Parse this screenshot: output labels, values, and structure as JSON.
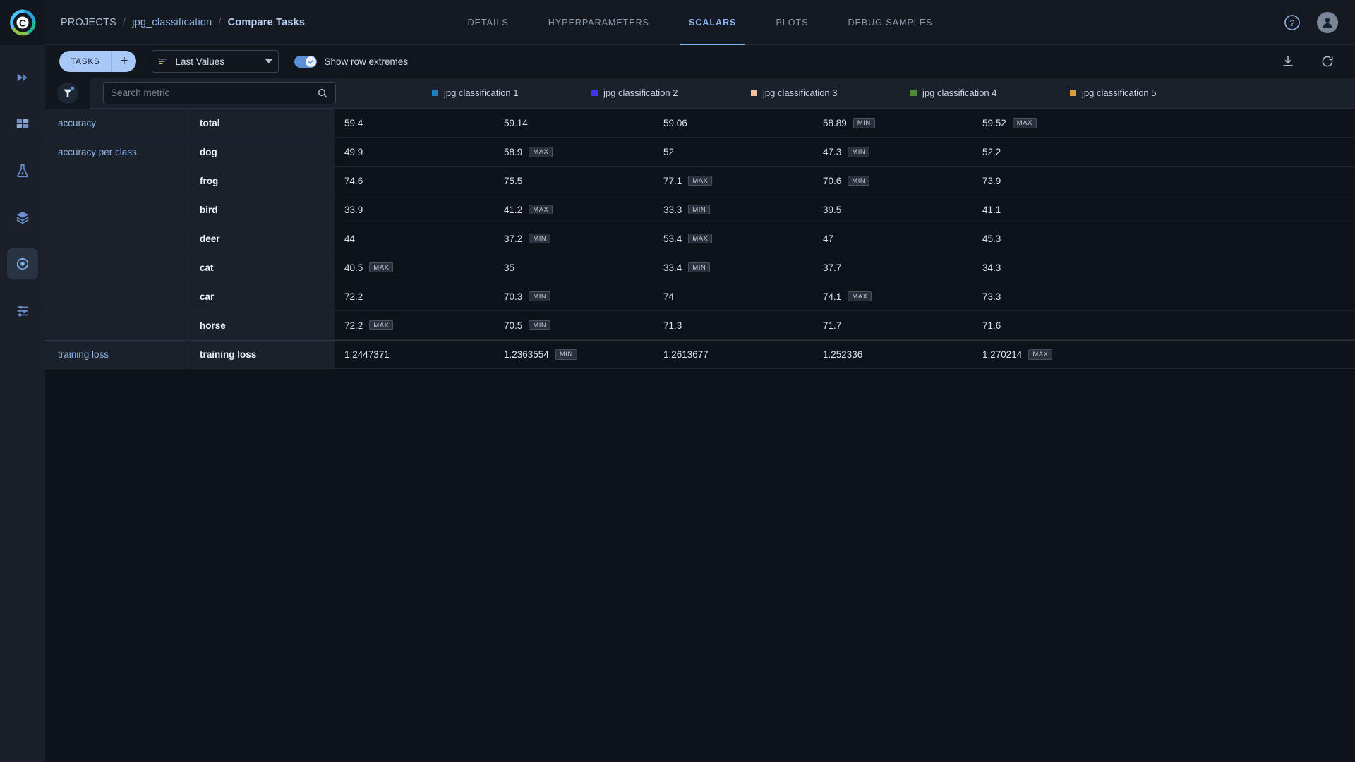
{
  "app": {
    "logo_icon": "clearml-logo-icon"
  },
  "sidebar": {
    "items": [
      {
        "name": "pipelines",
        "icon": "rocket-icon",
        "active": false
      },
      {
        "name": "datasets",
        "icon": "grid-icon",
        "active": false
      },
      {
        "name": "experiments",
        "icon": "flask-icon",
        "active": false
      },
      {
        "name": "models",
        "icon": "layers-icon",
        "active": false
      },
      {
        "name": "projects",
        "icon": "atom-icon",
        "active": true
      },
      {
        "name": "settings",
        "icon": "sliders-icon",
        "active": false
      }
    ]
  },
  "header": {
    "breadcrumb": {
      "projects": "PROJECTS",
      "separator": "/",
      "project": "jpg_classification",
      "current": "Compare Tasks"
    },
    "tabs": [
      {
        "label": "DETAILS",
        "active": false
      },
      {
        "label": "HYPERPARAMETERS",
        "active": false
      },
      {
        "label": "SCALARS",
        "active": true
      },
      {
        "label": "PLOTS",
        "active": false
      },
      {
        "label": "DEBUG SAMPLES",
        "active": false
      }
    ],
    "help_icon": "help-circle-icon",
    "avatar_icon": "user-avatar-icon"
  },
  "toolbar": {
    "tasks_label": "TASKS",
    "add_label": "+",
    "values_select": "Last Values",
    "values_icon": "sort-lines-icon",
    "toggle_label": "Show row extremes",
    "toggle_on": true,
    "download_icon": "download-icon",
    "refresh_icon": "refresh-icon"
  },
  "search": {
    "placeholder": "Search metric",
    "value": "",
    "search_icon": "search-icon",
    "filter_icon": "filter-funnel-icon"
  },
  "table": {
    "columns": [
      {
        "label": "jpg classification 1",
        "color": "#1f7fb8"
      },
      {
        "label": "jpg classification 2",
        "color": "#3b36e8"
      },
      {
        "label": "jpg classification 3",
        "color": "#efc29c"
      },
      {
        "label": "jpg classification 4",
        "color": "#4e8a3a"
      },
      {
        "label": "jpg classification 5",
        "color": "#d8a03a"
      }
    ],
    "rows": [
      {
        "metric": "accuracy",
        "variant": "total",
        "group_start": true,
        "values": [
          {
            "value": "59.4",
            "badge": ""
          },
          {
            "value": "59.14",
            "badge": ""
          },
          {
            "value": "59.06",
            "badge": ""
          },
          {
            "value": "58.89",
            "badge": "MIN"
          },
          {
            "value": "59.52",
            "badge": "MAX"
          }
        ]
      },
      {
        "metric": "accuracy per class",
        "variant": "dog",
        "group_start": true,
        "values": [
          {
            "value": "49.9",
            "badge": ""
          },
          {
            "value": "58.9",
            "badge": "MAX"
          },
          {
            "value": "52",
            "badge": ""
          },
          {
            "value": "47.3",
            "badge": "MIN"
          },
          {
            "value": "52.2",
            "badge": ""
          }
        ]
      },
      {
        "metric": "",
        "variant": "frog",
        "group_start": false,
        "values": [
          {
            "value": "74.6",
            "badge": ""
          },
          {
            "value": "75.5",
            "badge": ""
          },
          {
            "value": "77.1",
            "badge": "MAX"
          },
          {
            "value": "70.6",
            "badge": "MIN"
          },
          {
            "value": "73.9",
            "badge": ""
          }
        ]
      },
      {
        "metric": "",
        "variant": "bird",
        "group_start": false,
        "values": [
          {
            "value": "33.9",
            "badge": ""
          },
          {
            "value": "41.2",
            "badge": "MAX"
          },
          {
            "value": "33.3",
            "badge": "MIN"
          },
          {
            "value": "39.5",
            "badge": ""
          },
          {
            "value": "41.1",
            "badge": ""
          }
        ]
      },
      {
        "metric": "",
        "variant": "deer",
        "group_start": false,
        "values": [
          {
            "value": "44",
            "badge": ""
          },
          {
            "value": "37.2",
            "badge": "MIN"
          },
          {
            "value": "53.4",
            "badge": "MAX"
          },
          {
            "value": "47",
            "badge": ""
          },
          {
            "value": "45.3",
            "badge": ""
          }
        ]
      },
      {
        "metric": "",
        "variant": "cat",
        "group_start": false,
        "values": [
          {
            "value": "40.5",
            "badge": "MAX"
          },
          {
            "value": "35",
            "badge": ""
          },
          {
            "value": "33.4",
            "badge": "MIN"
          },
          {
            "value": "37.7",
            "badge": ""
          },
          {
            "value": "34.3",
            "badge": ""
          }
        ]
      },
      {
        "metric": "",
        "variant": "car",
        "group_start": false,
        "values": [
          {
            "value": "72.2",
            "badge": ""
          },
          {
            "value": "70.3",
            "badge": "MIN"
          },
          {
            "value": "74",
            "badge": ""
          },
          {
            "value": "74.1",
            "badge": "MAX"
          },
          {
            "value": "73.3",
            "badge": ""
          }
        ]
      },
      {
        "metric": "",
        "variant": "horse",
        "group_start": false,
        "values": [
          {
            "value": "72.2",
            "badge": "MAX"
          },
          {
            "value": "70.5",
            "badge": "MIN"
          },
          {
            "value": "71.3",
            "badge": ""
          },
          {
            "value": "71.7",
            "badge": ""
          },
          {
            "value": "71.6",
            "badge": ""
          }
        ]
      },
      {
        "metric": "training loss",
        "variant": "training loss",
        "group_start": true,
        "values": [
          {
            "value": "1.2447371",
            "badge": ""
          },
          {
            "value": "1.2363554",
            "badge": "MIN"
          },
          {
            "value": "1.2613677",
            "badge": ""
          },
          {
            "value": "1.252336",
            "badge": ""
          },
          {
            "value": "1.270214",
            "badge": "MAX"
          }
        ]
      }
    ]
  }
}
